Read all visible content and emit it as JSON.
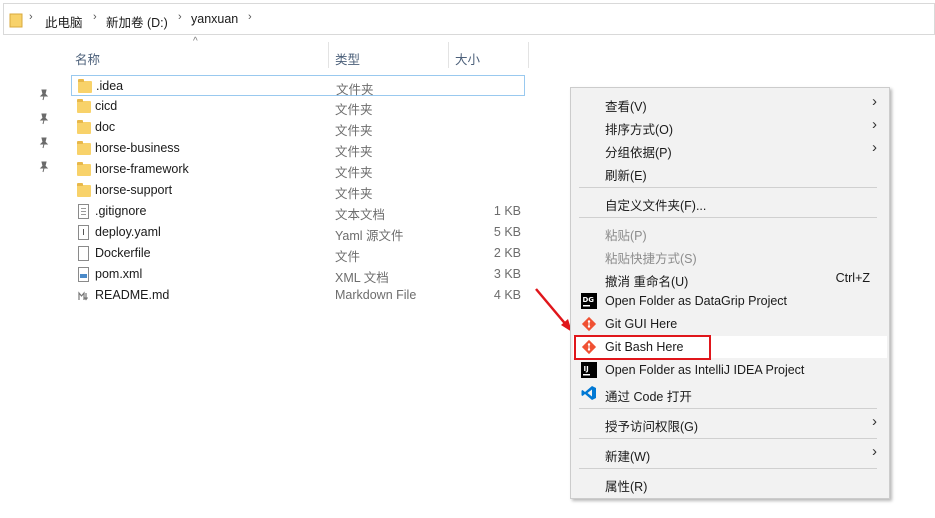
{
  "breadcrumb": {
    "items": [
      "此电脑",
      "新加卷 (D:)",
      "yanxuan"
    ]
  },
  "columns": {
    "name": "名称",
    "type": "类型",
    "size": "大小"
  },
  "files": [
    {
      "name": ".idea",
      "type": "文件夹",
      "size": "",
      "icon": "folder-icon"
    },
    {
      "name": "cicd",
      "type": "文件夹",
      "size": "",
      "icon": "folder-icon"
    },
    {
      "name": "doc",
      "type": "文件夹",
      "size": "",
      "icon": "folder-icon"
    },
    {
      "name": "horse-business",
      "type": "文件夹",
      "size": "",
      "icon": "folder-icon"
    },
    {
      "name": "horse-framework",
      "type": "文件夹",
      "size": "",
      "icon": "folder-icon"
    },
    {
      "name": "horse-support",
      "type": "文件夹",
      "size": "",
      "icon": "folder-icon"
    },
    {
      "name": ".gitignore",
      "type": "文本文档",
      "size": "1 KB",
      "icon": "text-file-icon"
    },
    {
      "name": "deploy.yaml",
      "type": "Yaml 源文件",
      "size": "5 KB",
      "icon": "yaml-file-icon"
    },
    {
      "name": "Dockerfile",
      "type": "文件",
      "size": "2 KB",
      "icon": "file-icon"
    },
    {
      "name": "pom.xml",
      "type": "XML 文档",
      "size": "3 KB",
      "icon": "xml-file-icon"
    },
    {
      "name": "README.md",
      "type": "Markdown File",
      "size": "4 KB",
      "icon": "markdown-file-icon"
    }
  ],
  "menu": {
    "view": "查看(V)",
    "sort": "排序方式(O)",
    "group": "分组依据(P)",
    "refresh": "刷新(E)",
    "customize": "自定义文件夹(F)...",
    "paste": "粘贴(P)",
    "paste_shortcut": "粘贴快捷方式(S)",
    "undo": "撤消 重命名(U)",
    "undo_shortcut": "Ctrl+Z",
    "datagrip": "Open Folder as DataGrip Project",
    "git_gui": "Git GUI Here",
    "git_bash": "Git Bash Here",
    "intellij": "Open Folder as IntelliJ IDEA Project",
    "vscode": "通过 Code 打开",
    "give_access": "授予访问权限(G)",
    "new": "新建(W)",
    "properties": "属性(R)"
  },
  "colors": {
    "highlight_box": "#e0161b",
    "arrow": "#e0161b",
    "folder": "#f8d26a",
    "git": "#f05133"
  }
}
